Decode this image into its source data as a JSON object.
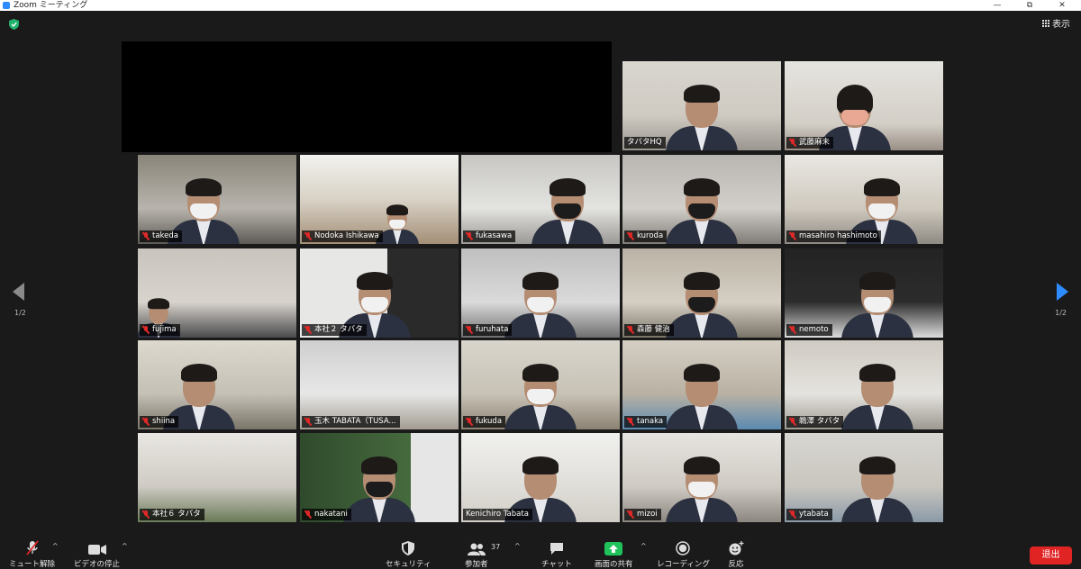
{
  "window": {
    "title": "Zoom ミーティング",
    "minimize": "—",
    "restore": "⧉",
    "close": "✕"
  },
  "view_button": {
    "label": "表示"
  },
  "pagination": {
    "left": "1/2",
    "right": "1/2"
  },
  "participants": [
    {
      "name": "タバタHQ",
      "muted": false,
      "active": true
    },
    {
      "name": "武藤麻未",
      "muted": true
    },
    {
      "name": "takeda",
      "muted": true
    },
    {
      "name": "Nodoka Ishikawa",
      "muted": true
    },
    {
      "name": "fukasawa",
      "muted": true
    },
    {
      "name": "kuroda",
      "muted": true
    },
    {
      "name": "masahiro hashimoto",
      "muted": true
    },
    {
      "name": "fujima",
      "muted": true
    },
    {
      "name": "本社２ タバタ",
      "muted": true
    },
    {
      "name": "furuhata",
      "muted": true
    },
    {
      "name": "森藤 健治",
      "muted": true
    },
    {
      "name": "nemoto",
      "muted": true
    },
    {
      "name": "shiina",
      "muted": true
    },
    {
      "name": "玉木 TABATA（TUSA...",
      "muted": true
    },
    {
      "name": "fukuda",
      "muted": true
    },
    {
      "name": "tanaka",
      "muted": true
    },
    {
      "name": "鵜澤 タバタ",
      "muted": true
    },
    {
      "name": "本社６ タバタ",
      "muted": true
    },
    {
      "name": "nakatani",
      "muted": true
    },
    {
      "name": "Kenichiro Tabata",
      "muted": false
    },
    {
      "name": "mizoi",
      "muted": true
    },
    {
      "name": "ytabata",
      "muted": true
    }
  ],
  "toolbar": {
    "unmute": "ミュート解除",
    "stop_video": "ビデオの停止",
    "security": "セキュリティ",
    "participants": "参加者",
    "participants_count": "37",
    "chat": "チャット",
    "share_screen": "画面の共有",
    "record": "レコーディング",
    "reactions": "反応",
    "leave": "退出"
  },
  "colors": {
    "active_speaker": "#c9ea3f",
    "leave": "#e02424",
    "share": "#1fc35a",
    "accent": "#2d8cff"
  }
}
